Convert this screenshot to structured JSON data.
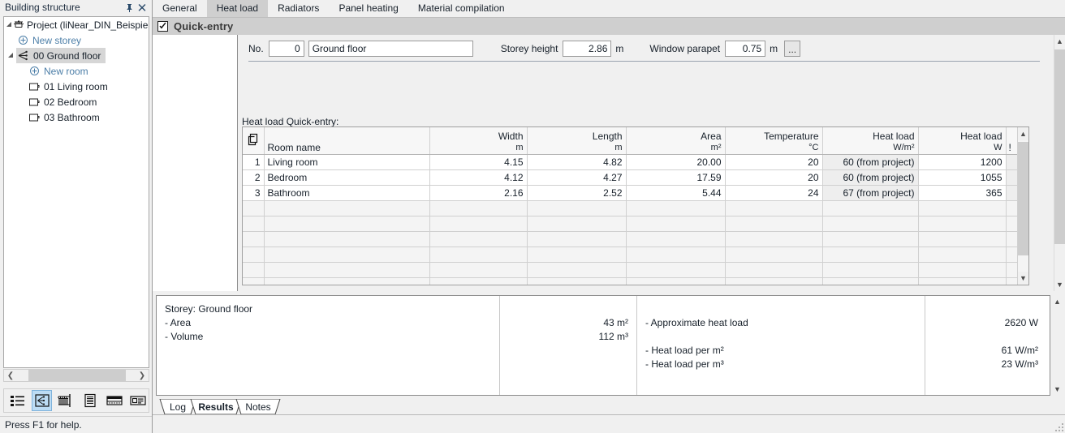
{
  "dock": {
    "title": "Building structure",
    "pin_icon": "pin-icon",
    "close_icon": "close-icon",
    "tree": [
      {
        "label": "Project (liNear_DIN_Beispiel,",
        "icon": "project-icon",
        "level": 0,
        "expander": "expanded",
        "link": false,
        "selected": false
      },
      {
        "label": "New storey",
        "icon": "plus-circle-icon",
        "level": 1,
        "expander": "none",
        "link": true,
        "selected": false
      },
      {
        "label": "00 Ground floor",
        "icon": "storey-icon",
        "level": 0,
        "expander": "expanded",
        "link": false,
        "selected": true
      },
      {
        "label": "New room",
        "icon": "plus-circle-icon",
        "level": 2,
        "expander": "none",
        "link": true,
        "selected": false
      },
      {
        "label": "01 Living room",
        "icon": "room-icon",
        "level": 2,
        "expander": "none",
        "link": false,
        "selected": false
      },
      {
        "label": "02 Bedroom",
        "icon": "room-icon",
        "level": 2,
        "expander": "none",
        "link": false,
        "selected": false
      },
      {
        "label": "03 Bathroom",
        "icon": "room-icon",
        "level": 2,
        "expander": "none",
        "link": false,
        "selected": false
      }
    ],
    "toolbar_icons": [
      "list-view-icon",
      "building-structure-icon",
      "radiator-icon",
      "document-icon",
      "layers-icon",
      "card-view-icon"
    ],
    "toolbar_active_index": 1
  },
  "statusbar": {
    "text": "Press F1 for help."
  },
  "tabs": {
    "items": [
      "General",
      "Heat load",
      "Radiators",
      "Panel heating",
      "Material compilation"
    ],
    "active": "Heat load"
  },
  "quick_entry": {
    "title": "Quick-entry",
    "checked": true
  },
  "form": {
    "no_label": "No.",
    "no_value": "0",
    "name_value": "Ground floor",
    "storey_height_label": "Storey height",
    "storey_height_value": "2.86",
    "storey_height_unit": "m",
    "window_parapet_label": "Window parapet",
    "window_parapet_value": "0.75",
    "window_parapet_unit": "m",
    "more_button": "..."
  },
  "table": {
    "caption": "Heat load Quick-entry:",
    "row_header_icon": "copy-pages-icon",
    "columns": [
      {
        "label": "Room name",
        "unit": "",
        "align": "l"
      },
      {
        "label": "Width",
        "unit": "m",
        "align": "r"
      },
      {
        "label": "Length",
        "unit": "m",
        "align": "r"
      },
      {
        "label": "Area",
        "unit": "m²",
        "align": "r"
      },
      {
        "label": "Temperature",
        "unit": "°C",
        "align": "r"
      },
      {
        "label": "Heat load",
        "unit": "W/m²",
        "align": "r"
      },
      {
        "label": "Heat load",
        "unit": "W",
        "align": "r"
      },
      {
        "label": "!",
        "unit": "",
        "align": "l"
      }
    ],
    "rows": [
      {
        "n": "1",
        "name": "Living room",
        "width": "4.15",
        "length": "4.82",
        "area": "20.00",
        "temperature": "20",
        "heat_load_m2": "60 (from project)",
        "heat_load_w": "1200",
        "flag": ""
      },
      {
        "n": "2",
        "name": "Bedroom",
        "width": "4.12",
        "length": "4.27",
        "area": "17.59",
        "temperature": "20",
        "heat_load_m2": "60 (from project)",
        "heat_load_w": "1055",
        "flag": ""
      },
      {
        "n": "3",
        "name": "Bathroom",
        "width": "2.16",
        "length": "2.52",
        "area": "5.44",
        "temperature": "24",
        "heat_load_m2": "67 (from project)",
        "heat_load_w": "365",
        "flag": ""
      }
    ],
    "empty_row_count": 7
  },
  "results": {
    "left": [
      "Storey: Ground floor",
      "- Area",
      "- Volume"
    ],
    "left_values": [
      "",
      "43 m²",
      "112 m³"
    ],
    "right": [
      "- Approximate heat load",
      "",
      "- Heat load per m²",
      "- Heat load per m³"
    ],
    "right_values": [
      "2620 W",
      "",
      "61 W/m²",
      "23 W/m³"
    ]
  },
  "bottom_tabs": {
    "items": [
      "Log",
      "Results",
      "Notes"
    ],
    "active": "Results"
  },
  "colors": {
    "window_bg": "#f0f0f0",
    "header_bar": "#cfcfcf",
    "selection": "#d6d6d6",
    "link_text": "#4d7fa8",
    "toolbar_active": "#bcdcf4"
  }
}
